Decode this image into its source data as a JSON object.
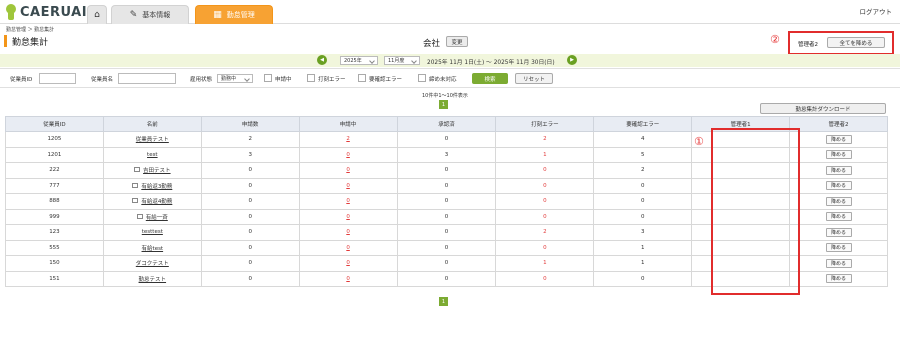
{
  "header": {
    "logo_text": "CAERUAI",
    "tabs": [
      {
        "label": "",
        "icon": "home-icon"
      },
      {
        "label": "基本情報",
        "icon": "edit-icon"
      },
      {
        "label": "勤怠管理",
        "icon": "calendar-icon"
      }
    ],
    "logout": "ログアウト"
  },
  "breadcrumb": "勤怠管理 ＞ 勤怠集計",
  "page_title": "勤怠集計",
  "company": {
    "label": "会社",
    "change_button": "変更"
  },
  "callouts": {
    "one": "①",
    "two": "②"
  },
  "manager2_label": "管理者2",
  "return_all_button": "全てを降める",
  "month_nav": {
    "prev_icon": "chevron-left-icon",
    "next_icon": "chevron-right-icon",
    "year": "2025年",
    "month": "11月度",
    "range": "2025年 11月 1日(土) ～ 2025年 11月 30日(日)"
  },
  "filters": {
    "employee_id_label": "従業員ID",
    "employee_name_label": "従業員名",
    "employment_status_label": "雇用状態",
    "employment_status_value": "勤務中",
    "checkboxes": [
      "申請中",
      "打刻エラー",
      "要確認エラー",
      "締め未対応"
    ],
    "search_button": "検索",
    "reset_button": "リセット"
  },
  "result_count": "10件中1～10件表示",
  "pagination": {
    "current": "1"
  },
  "download_button": "勤怠集計ダウンロード",
  "table": {
    "columns": [
      "従業員ID",
      "名前",
      "申請数",
      "申請中",
      "承認済",
      "打刻エラー",
      "要確認エラー",
      "管理者1",
      "管理者2"
    ],
    "return_label": "降める",
    "rows": [
      {
        "id": "1205",
        "name": "従業員テスト",
        "lock": false,
        "applied": "2",
        "pending": "2",
        "approved": "0",
        "stamp_error": "2",
        "check_error": "4",
        "mgr1": ""
      },
      {
        "id": "1201",
        "name": "test",
        "lock": false,
        "applied": "3",
        "pending": "0",
        "approved": "3",
        "stamp_error": "1",
        "check_error": "5",
        "mgr1": ""
      },
      {
        "id": "222",
        "name": "吉田テスト",
        "lock": true,
        "applied": "0",
        "pending": "0",
        "approved": "0",
        "stamp_error": "0",
        "check_error": "2",
        "mgr1": ""
      },
      {
        "id": "777",
        "name": "有給返3勤務",
        "lock": true,
        "applied": "0",
        "pending": "0",
        "approved": "0",
        "stamp_error": "0",
        "check_error": "0",
        "mgr1": ""
      },
      {
        "id": "888",
        "name": "有給返4勤務",
        "lock": true,
        "applied": "0",
        "pending": "0",
        "approved": "0",
        "stamp_error": "0",
        "check_error": "0",
        "mgr1": ""
      },
      {
        "id": "999",
        "name": "有給一斉",
        "lock": true,
        "applied": "0",
        "pending": "0",
        "approved": "0",
        "stamp_error": "0",
        "check_error": "0",
        "mgr1": ""
      },
      {
        "id": "123",
        "name": "testtest",
        "lock": false,
        "applied": "0",
        "pending": "0",
        "approved": "0",
        "stamp_error": "2",
        "check_error": "3",
        "mgr1": ""
      },
      {
        "id": "555",
        "name": "有給test",
        "lock": false,
        "applied": "0",
        "pending": "0",
        "approved": "0",
        "stamp_error": "0",
        "check_error": "1",
        "mgr1": ""
      },
      {
        "id": "150",
        "name": "ダコクテスト",
        "lock": false,
        "applied": "0",
        "pending": "0",
        "approved": "0",
        "stamp_error": "1",
        "check_error": "1",
        "mgr1": ""
      },
      {
        "id": "151",
        "name": "勤怠テスト",
        "lock": false,
        "applied": "0",
        "pending": "0",
        "approved": "0",
        "stamp_error": "0",
        "check_error": "0",
        "mgr1": ""
      }
    ]
  },
  "colors": {
    "accent": "#f39519",
    "green": "#7cab32",
    "callout_red": "#e12c2c",
    "error_red": "#e23a3a"
  }
}
